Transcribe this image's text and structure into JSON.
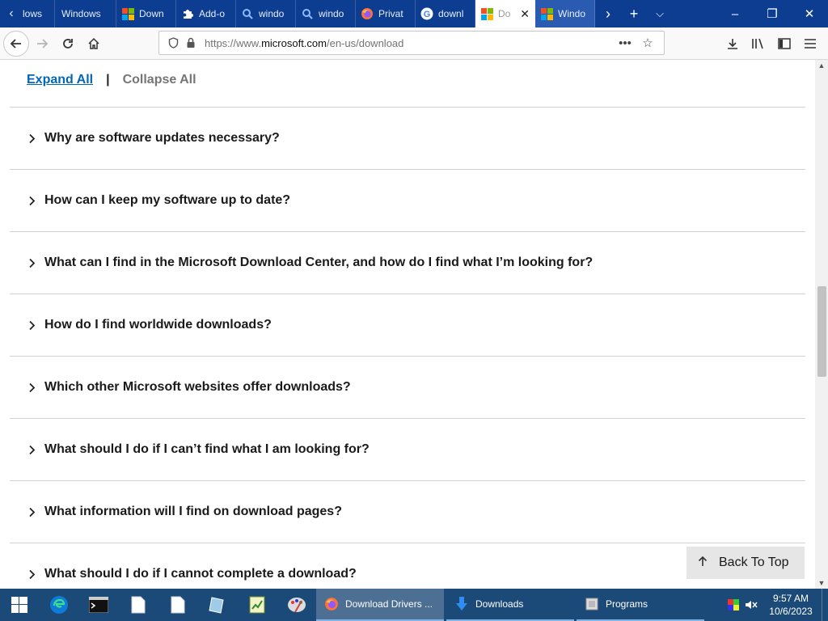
{
  "tabs": [
    {
      "label": "lows",
      "icon": "none"
    },
    {
      "label": "Windows",
      "icon": "none"
    },
    {
      "label": "Down",
      "icon": "microsoft-logo-icon"
    },
    {
      "label": "Add-o",
      "icon": "puzzle-piece-icon"
    },
    {
      "label": "windo",
      "icon": "search-icon"
    },
    {
      "label": "windo",
      "icon": "search-icon"
    },
    {
      "label": "Privat",
      "icon": "firefox-icon"
    },
    {
      "label": "downl",
      "icon": "google-icon"
    },
    {
      "label": "Do",
      "icon": "microsoft-logo-icon",
      "active": true
    },
    {
      "label": "Windo",
      "icon": "microsoft-logo-icon"
    }
  ],
  "address": {
    "prefix": "https://www.",
    "domain": "microsoft.com",
    "path": "/en-us/download"
  },
  "page": {
    "expand_all": "Expand All",
    "separator": "|",
    "collapse_all": "Collapse All",
    "faqs": [
      "Why are software updates necessary?",
      "How can I keep my software up to date?",
      "What can I find in the Microsoft Download Center, and how do I find what I’m looking for?",
      "How do I find worldwide downloads?",
      "Which other Microsoft websites offer downloads?",
      "What should I do if I can’t find what I am looking for?",
      "What information will I find on download pages?",
      "What should I do if I cannot complete a download?"
    ],
    "back_to_top": "Back To Top"
  },
  "taskbar": {
    "apps": [
      {
        "label": "Download Drivers ...",
        "icon": "firefox-icon",
        "active": true
      },
      {
        "label": "Downloads",
        "icon": "download-arrow-icon",
        "active": false
      },
      {
        "label": "Programs",
        "icon": "programs-folder-icon",
        "active": false
      }
    ],
    "time": "9:57 AM",
    "date": "10/6/2023"
  },
  "colors": {
    "tabstrip": "#0c3d91",
    "link": "#0067b8",
    "taskbar": "#1c4a78"
  }
}
